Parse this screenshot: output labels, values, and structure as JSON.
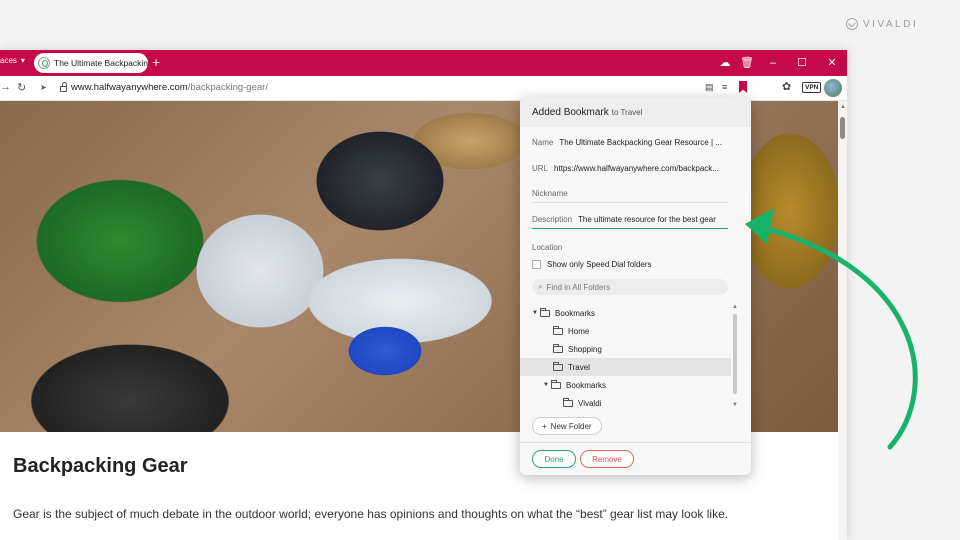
{
  "brand": {
    "name": "VIVALDI"
  },
  "tabbar": {
    "workspace_label": "aces",
    "tab_title": "The Ultimate Backpacking",
    "new_tab_symbol": "+",
    "accent_color": "#c40a4a"
  },
  "address": {
    "domain": "www.halfwayanywhere.com",
    "path": "/backpacking-gear/"
  },
  "popup": {
    "title": "Added Bookmark",
    "subtitle": "to Travel",
    "name_label": "Name",
    "name_value": "The Ultimate Backpacking Gear Resource | ...",
    "url_label": "URL",
    "url_value": "https://www.halfwayanywhere.com/backpack...",
    "nickname_label": "Nickname",
    "nickname_value": "",
    "description_label": "Description",
    "description_value": "The ultimate resource for the best gear",
    "location_label": "Location",
    "speed_dial_label": "Show only Speed Dial folders",
    "find_placeholder": "Find in All Folders",
    "folders": [
      {
        "label": "Bookmarks"
      },
      {
        "label": "Home"
      },
      {
        "label": "Shopping"
      },
      {
        "label": "Travel"
      },
      {
        "label": "Bookmarks"
      },
      {
        "label": "Vivaldi"
      }
    ],
    "new_folder_label": "New Folder",
    "done_label": "Done",
    "remove_label": "Remove",
    "highlight_color": "#2aa177"
  },
  "article": {
    "heading": "Backpacking Gear",
    "body": "Gear is the subject of much debate in the outdoor world; everyone has opinions and thoughts on what the “best” gear list may look like."
  }
}
